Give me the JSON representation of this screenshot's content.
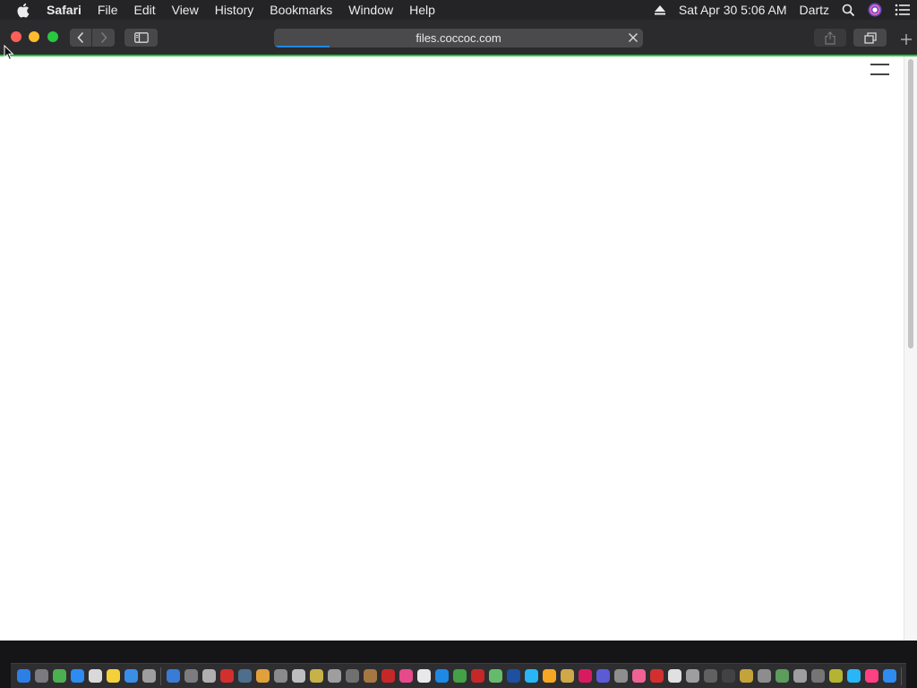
{
  "menubar": {
    "app_name": "Safari",
    "items": [
      "File",
      "Edit",
      "View",
      "History",
      "Bookmarks",
      "Window",
      "Help"
    ],
    "clock": "Sat Apr 30  5:06 AM",
    "user": "Dartz",
    "status_icons": [
      "eject-icon",
      "spotlight-search-icon",
      "siri-icon",
      "notification-center-icon"
    ]
  },
  "toolbar": {
    "url": "files.coccoc.com",
    "load_progress": 0.15,
    "buttons": [
      "back-icon",
      "forward-icon",
      "sidebar-icon",
      "share-icon",
      "tab-overview-icon",
      "new-tab-icon"
    ]
  },
  "page": {
    "menu_icon": "hamburger-menu-icon",
    "scroll_fraction_visible": 0.5
  },
  "colors": {
    "accent_blue": "#1e88e5",
    "loading_green": "#27c840",
    "close": "#fe5f57",
    "minimize": "#febc2e",
    "zoom": "#28c840"
  },
  "dock": {
    "icon_colors": [
      "#2d7fe6",
      "#7b7b7f",
      "#4caf50",
      "#2e8bf0",
      "#d9d9d9",
      "#f4d13b",
      "#3a8ee6",
      "#9e9e9e",
      "#3a7bd5",
      "#7c7c80",
      "#b0b0b0",
      "#d32f2f",
      "#4e6e8e",
      "#e0a03a",
      "#8a8a8a",
      "#bdbdbd",
      "#c7b24a",
      "#9e9e9e",
      "#707070",
      "#a57843",
      "#c62828",
      "#e64a8a",
      "#e8e8e8",
      "#1e88e5",
      "#43a047",
      "#c62828",
      "#66bb6a",
      "#1e4fa0",
      "#29b6f6",
      "#f5a623",
      "#cfa848",
      "#d81b60",
      "#5b5bd6",
      "#8e8e8e",
      "#f06292",
      "#d32f2f",
      "#e0e0e0",
      "#9e9e9e",
      "#616161",
      "#424242",
      "#c4a43a",
      "#8d8d8d",
      "#5c9c5c",
      "#9e9e9e",
      "#757575",
      "#b4b432",
      "#29b6f6",
      "#ff4081",
      "#2e8bf0",
      "#4fa3e8",
      "#6d6d6d"
    ]
  }
}
